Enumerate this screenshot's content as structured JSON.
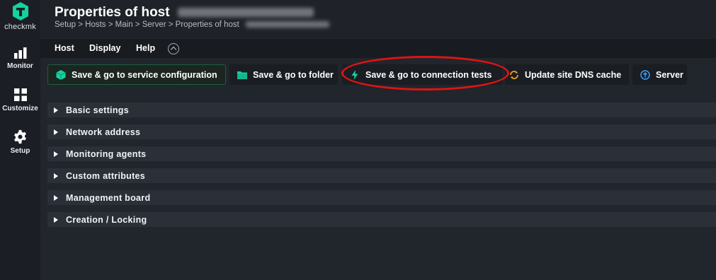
{
  "app": {
    "brand": "checkmk"
  },
  "sidebar": {
    "items": [
      {
        "label": "Monitor",
        "icon": "bar-chart-icon"
      },
      {
        "label": "Customize",
        "icon": "grid-icon"
      },
      {
        "label": "Setup",
        "icon": "gear-icon"
      }
    ]
  },
  "header": {
    "title": "Properties of host",
    "breadcrumb": "Setup > Hosts > Main > Server > Properties of host"
  },
  "menu": {
    "items": [
      "Host",
      "Display",
      "Help"
    ],
    "toggle_icon": "chevron-up-icon"
  },
  "toolbar": {
    "buttons": [
      {
        "label": "Save & go to service configuration",
        "icon": "cube-icon"
      },
      {
        "label": "Save & go to folder",
        "icon": "folder-icon"
      },
      {
        "label": "Save & go to connection tests",
        "icon": "lightning-icon"
      },
      {
        "label": "Update site DNS cache",
        "icon": "refresh-icon"
      },
      {
        "label": "Server",
        "icon": "upload-circle-icon"
      }
    ]
  },
  "sections": [
    "Basic settings",
    "Network address",
    "Monitoring agents",
    "Custom attributes",
    "Management board",
    "Creation / Locking"
  ],
  "colors": {
    "accent": "#15d1a0",
    "highlight": "#e01313"
  }
}
